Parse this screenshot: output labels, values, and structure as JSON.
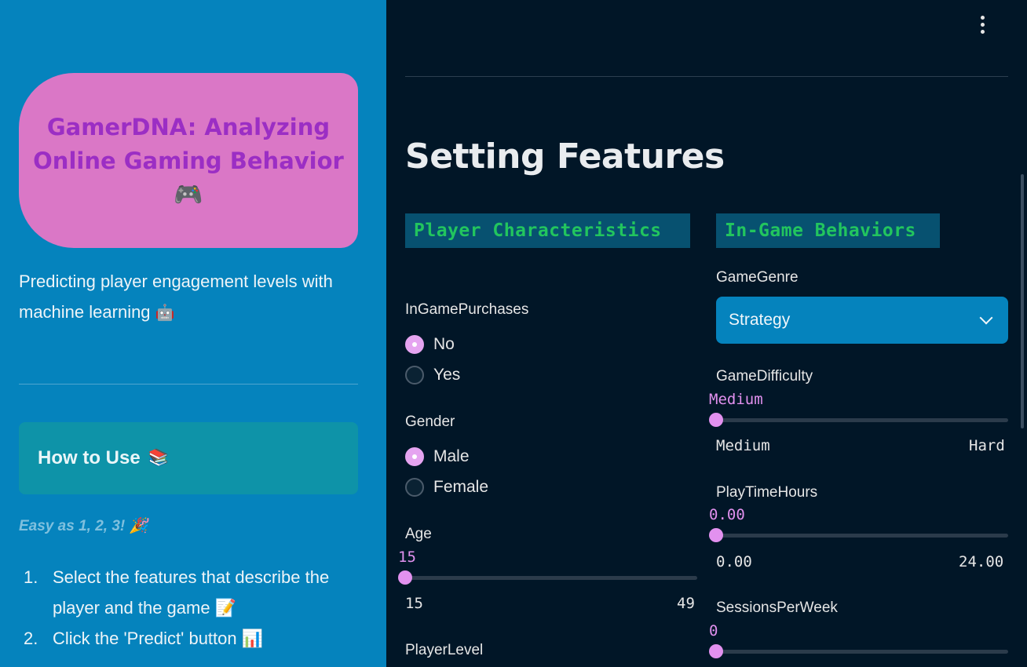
{
  "sidebar": {
    "hero_title": "GamerDNA: Analyzing Online Gaming Behavior",
    "hero_icon": "🎮",
    "tagline": "Predicting player engagement levels with machine learning",
    "tagline_icon": "🤖",
    "howto_title": "How to Use",
    "howto_icon": "📚",
    "easy_text": "Easy as 1, 2, 3!",
    "easy_icon": "🎉",
    "steps": [
      {
        "num": "1.",
        "text": "Select the features that describe the player and the game",
        "icon": "📝"
      },
      {
        "num": "2.",
        "text": "Click the 'Predict' button",
        "icon": "📊"
      }
    ]
  },
  "main": {
    "page_title": "Setting Features",
    "player_section": "Player Characteristics",
    "behavior_section": "In-Game Behaviors",
    "in_game_purchases": {
      "label": "InGamePurchases",
      "options": [
        "No",
        "Yes"
      ],
      "selected": "No"
    },
    "gender": {
      "label": "Gender",
      "options": [
        "Male",
        "Female"
      ],
      "selected": "Male"
    },
    "age": {
      "label": "Age",
      "value": "15",
      "min": "15",
      "max": "49",
      "fraction": 0.0
    },
    "player_level": {
      "label": "PlayerLevel"
    },
    "game_genre": {
      "label": "GameGenre",
      "value": "Strategy"
    },
    "game_difficulty": {
      "label": "GameDifficulty",
      "value": "Medium",
      "min": "Medium",
      "max": "Hard",
      "fraction": 0.0
    },
    "play_time": {
      "label": "PlayTimeHours",
      "value": "0.00",
      "min": "0.00",
      "max": "24.00",
      "fraction": 0.0
    },
    "sessions": {
      "label": "SessionsPerWeek",
      "value": "0",
      "fraction": 0.0
    }
  },
  "colors": {
    "sidebar_bg": "#0583bd",
    "main_bg": "#011627",
    "hero_bg": "#da77c6",
    "accent": "#e291ef",
    "section_text": "#22c55e"
  }
}
